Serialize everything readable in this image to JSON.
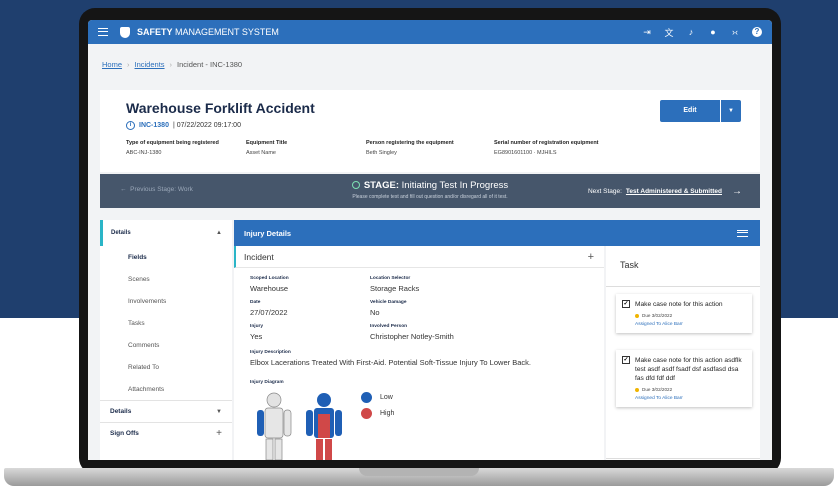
{
  "app": {
    "title_bold": "SAFETY",
    "title_rest": "MANAGEMENT SYSTEM",
    "icons": [
      "logout-icon",
      "translate-icon",
      "bell-icon",
      "user-icon",
      "collapse-icon",
      "help-icon"
    ]
  },
  "breadcrumb": {
    "home": "Home",
    "incidents": "Incidents",
    "current": "Incident - INC-1380"
  },
  "incident": {
    "title": "Warehouse Forklift Accident",
    "id": "INC-1380",
    "datetime": "| 07/22/2022 09:17:00",
    "edit_label": "Edit",
    "meta": [
      {
        "key": "Type of equipment being registered",
        "value": "ABC-INJ-1380"
      },
      {
        "key": "Equipment Title",
        "value": "Asset Name"
      },
      {
        "key": "Person registering the equipment",
        "value": "Beth Singley"
      },
      {
        "key": "Serial number of registration equipment",
        "value": "EG8901601100 · MJHILS"
      }
    ]
  },
  "stage": {
    "previous": "Previous Stage: Work",
    "label": "STAGE:",
    "name": "Initiating Test In Progress",
    "subtitle": "Please complete test and fill out question and/or disregard all of it test.",
    "next_prefix": "Next Stage:",
    "next_name": "Test Administered & Submitted"
  },
  "nav": {
    "header": "Details",
    "items": [
      "Fields",
      "Scenes",
      "Involvements",
      "Tasks",
      "Comments",
      "Related To",
      "Attachments"
    ],
    "active_index": 0,
    "sections": [
      "Details",
      "Sign Offs"
    ]
  },
  "main": {
    "header": "Injury Details",
    "card_title": "Incident",
    "fields": {
      "scoped_location": {
        "key": "Scoped Location",
        "value": "Warehouse"
      },
      "location_selector": {
        "key": "Location Selector",
        "value": "Storage Racks"
      },
      "date": {
        "key": "Date",
        "value": "27/07/2022"
      },
      "vehicle_damage": {
        "key": "Vehicle Damage",
        "value": "No"
      },
      "injury": {
        "key": "Injury",
        "value": "Yes"
      },
      "involved_person": {
        "key": "Involved Person",
        "value": "Christopher Notley-Smith"
      },
      "injury_description": {
        "key": "Injury Description",
        "value": "Elbox Lacerations Treated With First-Aid. Potential Soft-Tissue Injury To Lower Back."
      }
    },
    "diagram_label": "Injury Diagram",
    "legend": [
      {
        "label": "Low",
        "color": "#1f5fb5"
      },
      {
        "label": "High",
        "color": "#d04848"
      }
    ]
  },
  "task": {
    "title": "Task",
    "items": [
      {
        "text": "Make case note for this action",
        "due": "Due 3/02/2022",
        "assigned": "Assigned To Alice Barr"
      },
      {
        "text": "Make case note for this action asdflk test asdf asdf fsadf dsf asdfasd dsa fas dfd fdf ddf",
        "due": "Due 3/02/2022",
        "assigned": "Assigned To Alice Barr"
      }
    ]
  }
}
